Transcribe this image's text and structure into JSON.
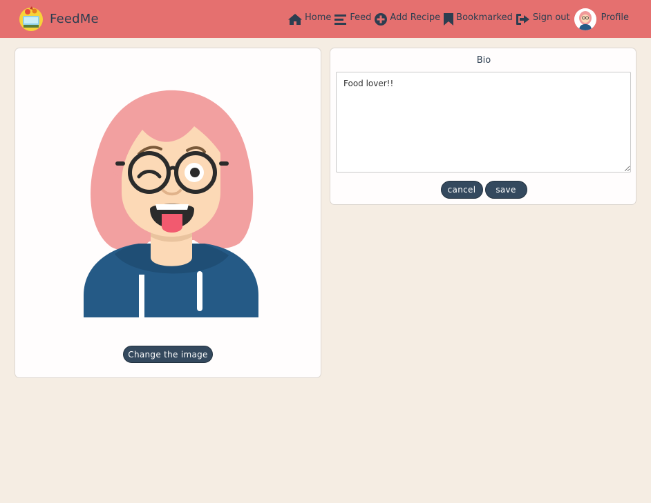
{
  "app": {
    "name": "FeedMe",
    "logo_icon": "chef-food-logo-icon"
  },
  "nav": {
    "items": [
      {
        "label": "Home",
        "icon": "home-icon"
      },
      {
        "label": "Feed",
        "icon": "bars-icon"
      },
      {
        "label": "Add Recipe",
        "icon": "plus-circle-icon"
      },
      {
        "label": "Bookmarked",
        "icon": "bookmark-icon"
      },
      {
        "label": "Sign out",
        "icon": "sign-out-icon"
      },
      {
        "label": "Profile",
        "icon": "avatar"
      }
    ]
  },
  "profile": {
    "avatar": "girl-with-glasses-avatar",
    "change_image_label": "Change the image"
  },
  "bio": {
    "label": "Bio",
    "value": "Food lover!!",
    "cancel_label": "cancel",
    "save_label": "save"
  },
  "colors": {
    "navbar": "#e5706f",
    "background": "#f5ede3",
    "button": "#34495e",
    "text": "#2c3e50"
  }
}
